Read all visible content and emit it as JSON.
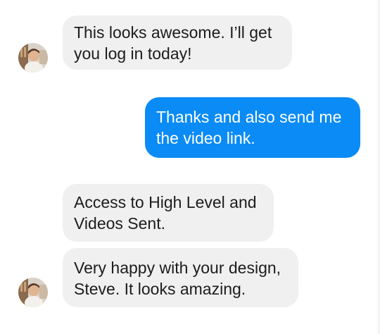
{
  "conversation": {
    "messages": [
      {
        "sender": "contact",
        "text": "This looks awesome. I’ll get you log in today!"
      },
      {
        "sender": "me",
        "text": "Thanks and also send me the video link."
      },
      {
        "sender": "contact",
        "text": "Access to High Level and Videos Sent."
      },
      {
        "sender": "contact",
        "text": "Very happy with your design, Steve. It looks amazing."
      }
    ]
  },
  "colors": {
    "outgoing_bubble": "#0a8bf6",
    "incoming_bubble": "#f0f0f0",
    "background": "#ffffff"
  },
  "icons": {
    "avatar": "contact-avatar-photo"
  }
}
